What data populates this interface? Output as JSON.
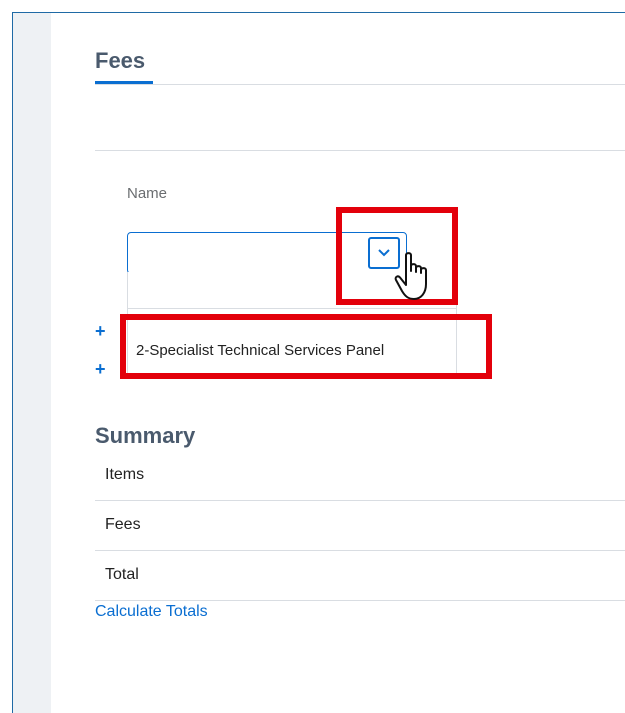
{
  "fees": {
    "title": "Fees",
    "name_label": "Name",
    "name_value": "",
    "option": "2-Specialist Technical Services Panel"
  },
  "summary": {
    "title": "Summary",
    "rows": [
      "Items",
      "Fees",
      "Total"
    ],
    "calculate_link": "Calculate Totals"
  },
  "add_symbol": "+",
  "colors": {
    "accent": "#0a6ed1",
    "highlight": "#e3000b",
    "heading": "#4a5a6d"
  }
}
